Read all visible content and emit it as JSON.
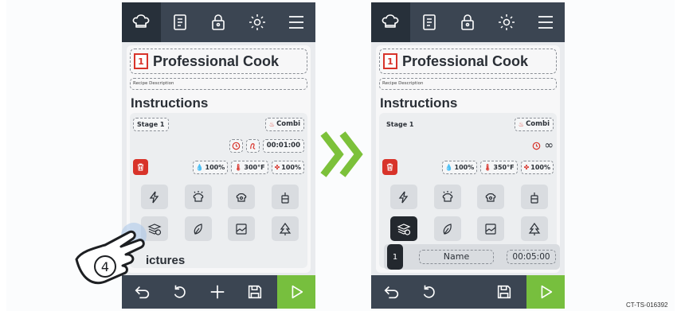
{
  "colors": {
    "accent_red": "#d8332a",
    "play_green": "#77bf3e",
    "bar_dark": "#3b4552",
    "arrow_green": "#7cc13a"
  },
  "topbar_icons": [
    "chef-hat-icon",
    "clipboard-icon",
    "lock-icon",
    "sun-icon",
    "menu-icon"
  ],
  "left": {
    "recipe_number": "1",
    "title": "Professional Cook",
    "description_placeholder": "Recipe Description",
    "section_instructions": "Instructions",
    "stage_label": "Stage 1",
    "mode_label": "Combi",
    "timer": "00:01:00",
    "humidity": "100%",
    "temperature": "300°F",
    "fan": "100%",
    "section_pictures": "ictures",
    "step_marker": "4"
  },
  "right": {
    "recipe_number": "1",
    "title": "Professional Cook",
    "description_placeholder": "Recipe Description",
    "section_instructions": "Instructions",
    "stage_label": "Stage 1",
    "mode_label": "Combi",
    "timer_symbol": "∞",
    "humidity": "100%",
    "temperature": "350°F",
    "fan": "100%",
    "step_number": "1",
    "step_name": "Name",
    "step_duration": "00:05:00"
  },
  "reference_code": "CT-TS-016392"
}
